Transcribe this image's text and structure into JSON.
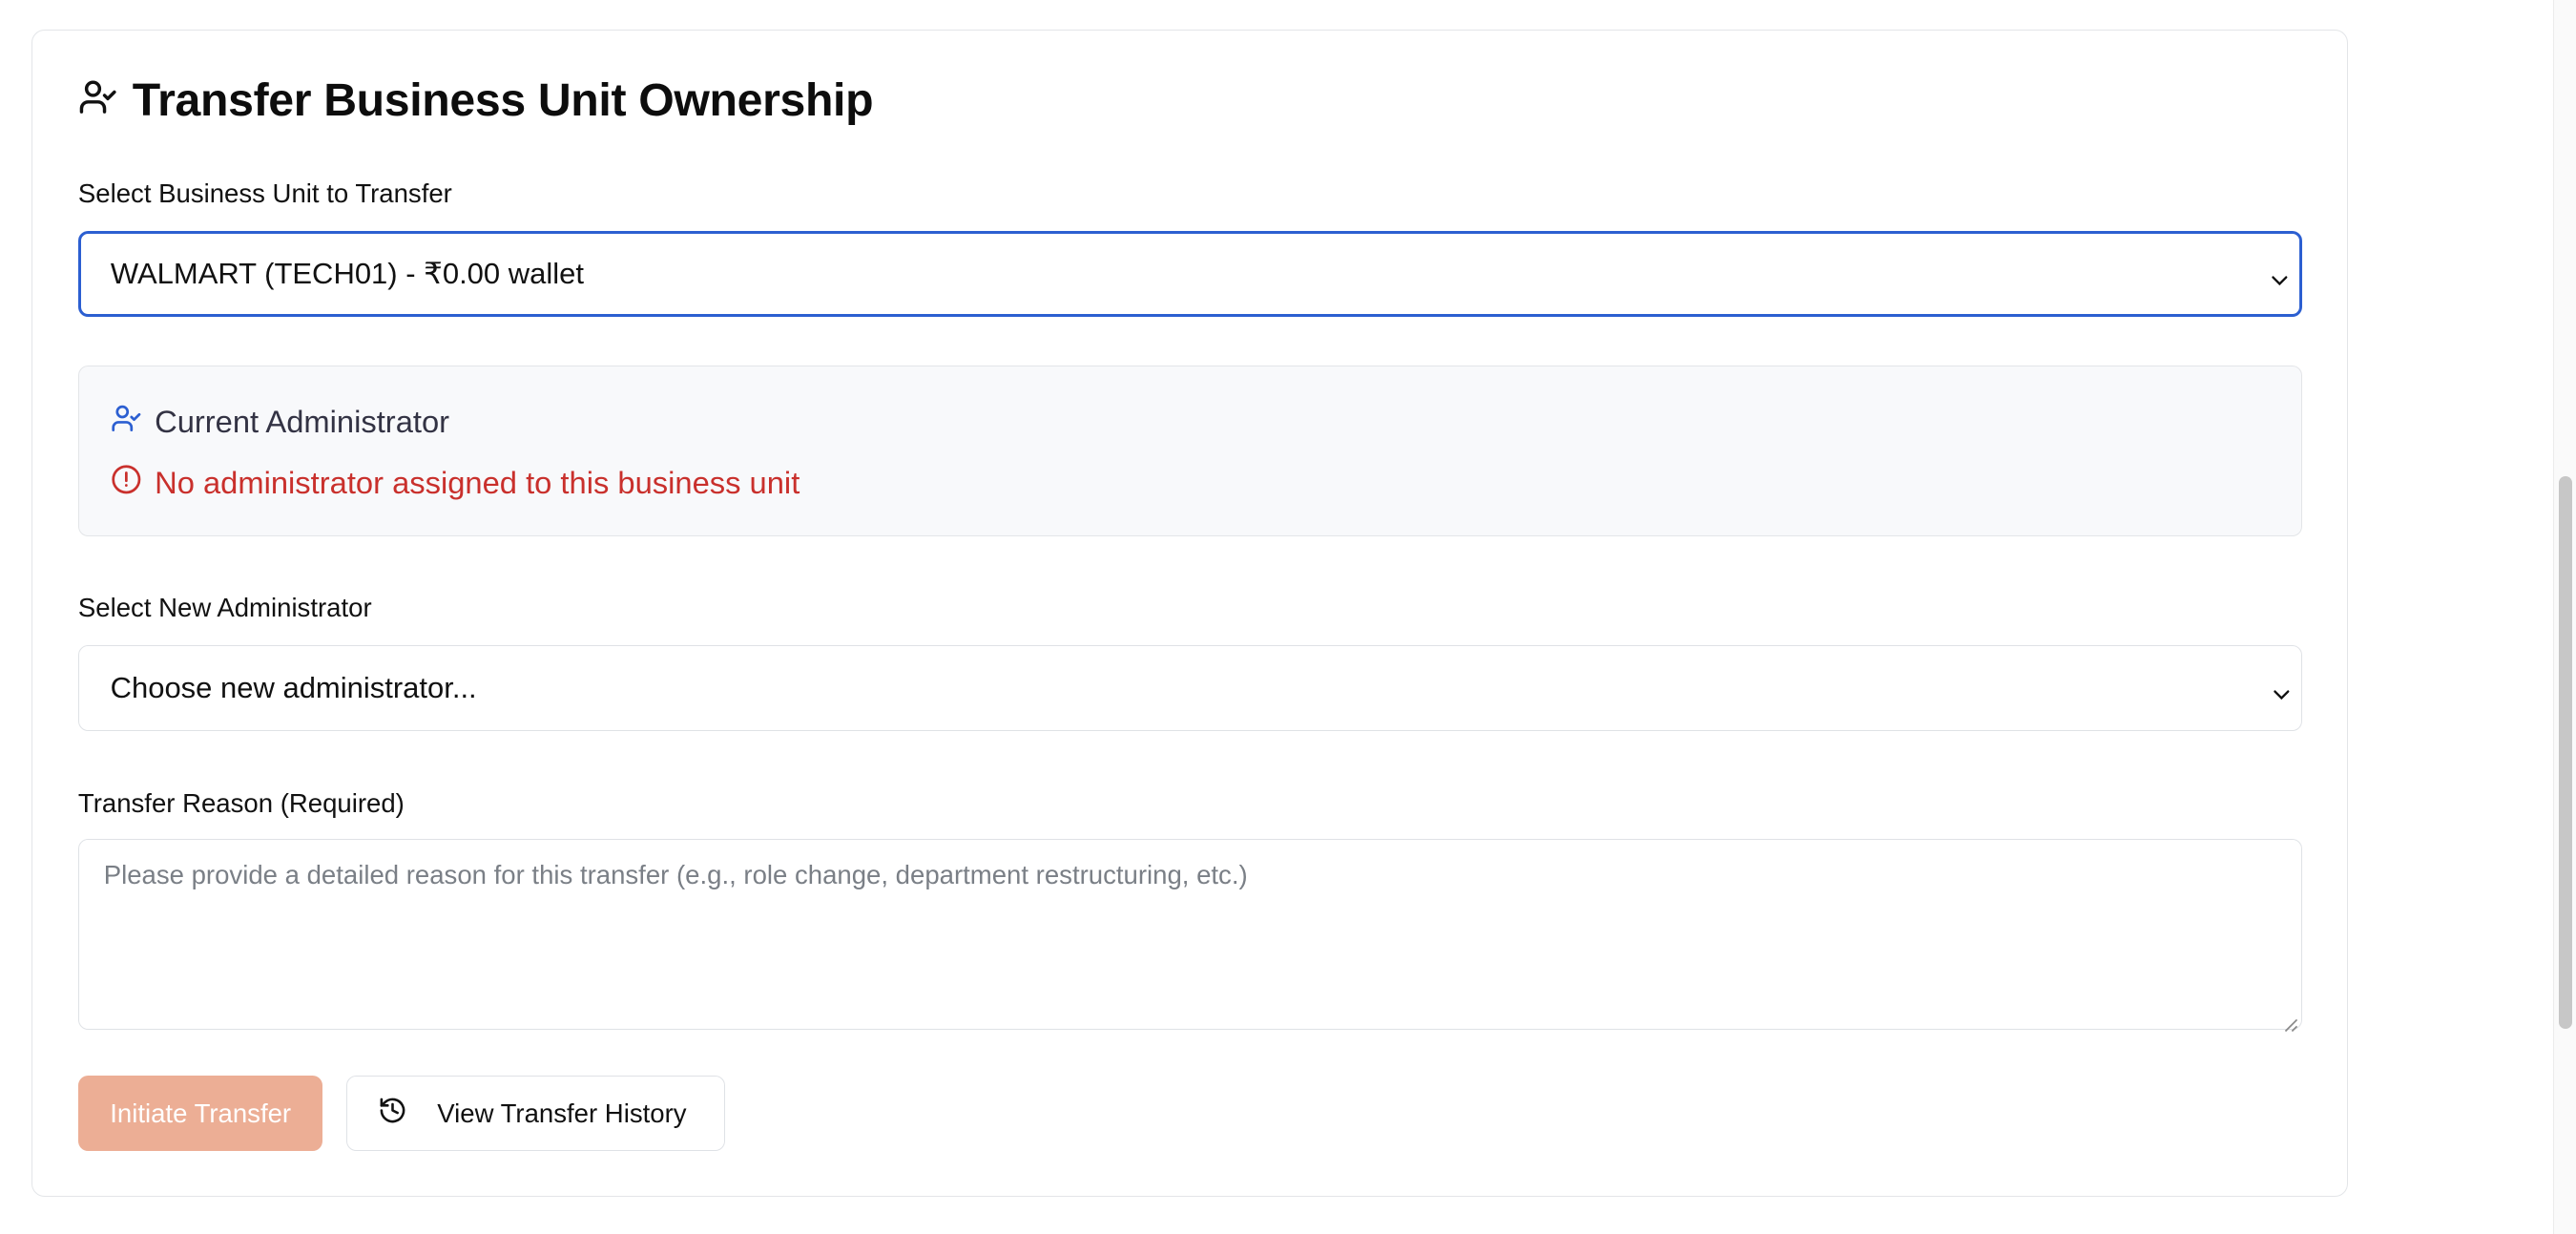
{
  "card": {
    "title": "Transfer Business Unit Ownership",
    "title_icon": "user-check-icon"
  },
  "business_unit": {
    "label": "Select Business Unit to Transfer",
    "selected": "WALMART (TECH01) - ₹0.00 wallet"
  },
  "current_admin": {
    "heading": "Current Administrator",
    "heading_icon": "user-check-icon",
    "warning": "No administrator assigned to this business unit",
    "warning_icon": "alert-circle-icon"
  },
  "new_admin": {
    "label": "Select New Administrator",
    "selected": "Choose new administrator..."
  },
  "reason": {
    "label": "Transfer Reason (Required)",
    "placeholder": "Please provide a detailed reason for this transfer (e.g., role change, department restructuring, etc.)",
    "value": ""
  },
  "actions": {
    "initiate": "Initiate Transfer",
    "history": "View Transfer History",
    "history_icon": "history-icon"
  },
  "colors": {
    "focus_border": "#2c5fd1",
    "error_text": "#c9302c",
    "primary_disabled": "#ecae95",
    "accent_icon": "#2c5fd1"
  }
}
